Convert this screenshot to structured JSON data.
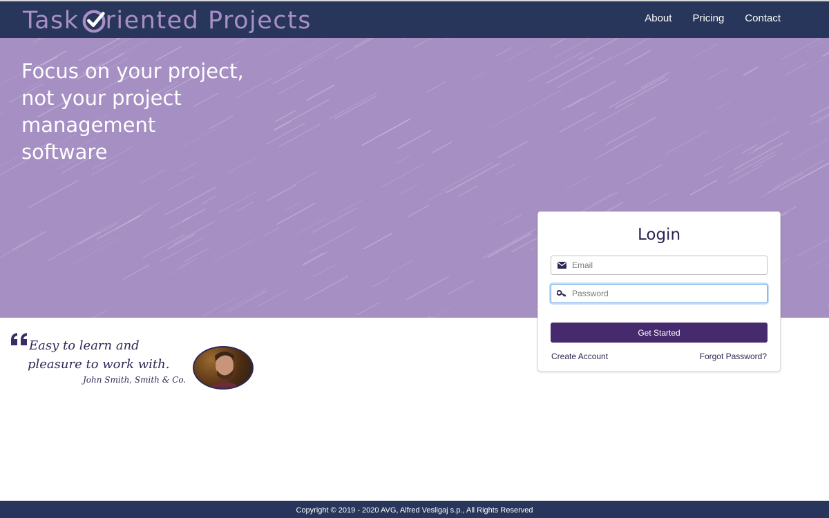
{
  "header": {
    "logo_text_before": "Task ",
    "logo_text_after": "riented Projects",
    "nav": [
      "About",
      "Pricing",
      "Contact"
    ]
  },
  "hero": {
    "headline_lines": [
      "Focus on your project,",
      "not your project",
      "management",
      "software"
    ]
  },
  "login": {
    "title": "Login",
    "email_placeholder": "Email",
    "password_placeholder": "Password",
    "submit_label": "Get Started",
    "create_account": "Create Account",
    "forgot_password": "Forgot Password?"
  },
  "testimonial": {
    "line1": "Easy to learn and",
    "line2": "pleasure to work with.",
    "author": "John Smith, Smith & Co."
  },
  "footer": {
    "copyright": "Copyright © 2019 - 2020 AVG, Alfred Vesligaj s.p., All Rights Reserved"
  },
  "colors": {
    "header_bg": "#27365a",
    "hero_bg": "#a68fc3",
    "logo": "#a98fc6",
    "button": "#452a6e"
  }
}
